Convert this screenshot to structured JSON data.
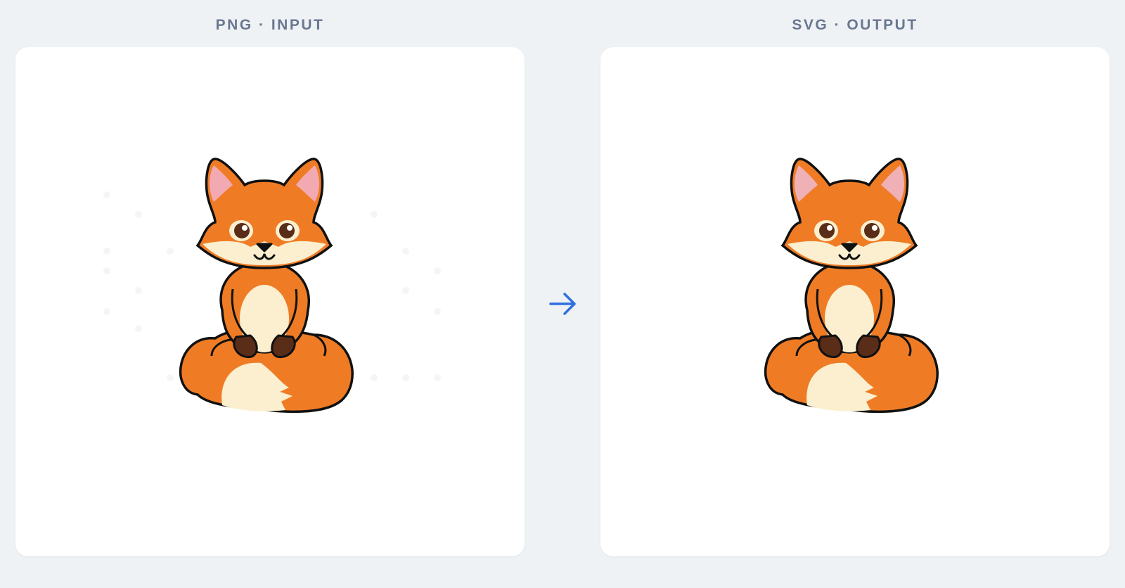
{
  "panels": {
    "input": {
      "label": "PNG · INPUT",
      "image": "fox-illustration-raster"
    },
    "output": {
      "label": "SVG · OUTPUT",
      "image": "fox-illustration-vector"
    }
  },
  "arrow": {
    "icon": "arrow-right-icon",
    "color": "#2f6fe0"
  },
  "colors": {
    "background": "#eff2f5",
    "card": "#ffffff",
    "label": "#6a7791",
    "fox_orange": "#ef7c25",
    "fox_cream": "#fbefcf",
    "ear_pink": "#f3a9b1",
    "paw_brown": "#5a2d19",
    "outline": "#111111"
  }
}
